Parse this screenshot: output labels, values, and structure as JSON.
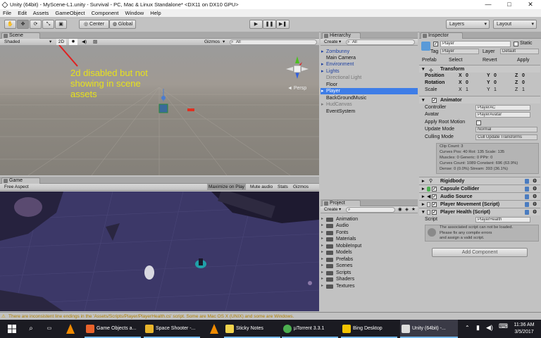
{
  "window": {
    "title": "Unity (64bit) - MyScene-L1.unity - Survival - PC, Mac & Linux Standalone* <DX11 on DX10 GPU>",
    "controls": [
      "—",
      "□",
      "✕"
    ]
  },
  "menu": [
    "File",
    "Edit",
    "Assets",
    "GameObject",
    "Component",
    "Window",
    "Help"
  ],
  "toolbar": {
    "center_label": "Center",
    "global_label": "Global",
    "layers_label": "Layers",
    "layout_label": "Layout"
  },
  "scene": {
    "tab": "Scene",
    "shading": "Shaded",
    "mode_2d": "2D",
    "gizmos": "Gizmos",
    "search": "All",
    "persp": "◄ Persp",
    "annotation": [
      "2d disabled but not",
      "showing in scene",
      "assets"
    ],
    "colors": {
      "annotation": "#e8e21a",
      "arrow": "#e02020"
    }
  },
  "game": {
    "tab": "Game",
    "aspect": "Free Aspect",
    "toggles": [
      "Maximize on Play",
      "Mute audio",
      "Stats",
      "Gizmos"
    ]
  },
  "hierarchy": {
    "tab": "Hierarchy",
    "create": "Create",
    "search": "All",
    "items": [
      {
        "label": "Zombunny",
        "style": "prefab"
      },
      {
        "label": "Main Camera",
        "style": "normal"
      },
      {
        "label": "Environment",
        "style": "prefab-arrow"
      },
      {
        "label": "Lights",
        "style": "prefab-arrow"
      },
      {
        "label": "Directional Light",
        "style": "dim"
      },
      {
        "label": "Floor",
        "style": "normal"
      },
      {
        "label": "Player",
        "style": "selected"
      },
      {
        "label": "BackGroundMusic",
        "style": "normal"
      },
      {
        "label": "HudCanvas",
        "style": "dim-arrow"
      },
      {
        "label": "EventSystem",
        "style": "normal"
      }
    ]
  },
  "project": {
    "tab": "Project",
    "create": "Create",
    "folders": [
      "Animation",
      "Audio",
      "Fonts",
      "Materials",
      "MobileInput",
      "Models",
      "Prefabs",
      "Scenes",
      "Scripts",
      "Shaders",
      "Textures"
    ]
  },
  "inspector": {
    "tab": "Inspector",
    "name": "Player",
    "static": "Static",
    "tag_label": "Tag",
    "tag": "Player",
    "layer_label": "Layer",
    "layer": "Default",
    "prefab_label": "Prefab",
    "prefab_buttons": [
      "Select",
      "Revert",
      "Apply"
    ],
    "transform": {
      "title": "Transform",
      "rows": [
        {
          "label": "Position",
          "x": "0",
          "y": "0",
          "z": "0"
        },
        {
          "label": "Rotation",
          "x": "0",
          "y": "0",
          "z": "0"
        },
        {
          "label": "Scale",
          "x": "1",
          "y": "1",
          "z": "1"
        }
      ]
    },
    "animator": {
      "title": "Animator",
      "controller_label": "Controller",
      "controller": "PlayerAC",
      "avatar_label": "Avatar",
      "avatar": "PlayerAvatar",
      "root_motion_label": "Apply Root Motion",
      "update_label": "Update Mode",
      "update": "Normal",
      "culling_label": "Culling Mode",
      "culling": "Cull Update Transforms",
      "info": [
        "Clip Count: 3",
        "Curves Pos: 40 Rot: 135 Scale: 135",
        "Muscles: 0 Generic: 0 PPtr: 0",
        "Curves Count: 1089 Constant: 696 (63.9%)",
        "Dense: 0 (0.0%) Stream: 393 (36.1%)"
      ]
    },
    "components": [
      "Rigidbody",
      "Capsule Collider",
      "Audio Source",
      "Player Movement (Script)",
      "Player Health (Script)"
    ],
    "script_label": "Script",
    "script_value": "PlayerHealth",
    "warning": [
      "The associated script can not be loaded.",
      "Please fix any compile errors",
      "and assign a valid script."
    ],
    "add_component": "Add Component"
  },
  "status": "There are inconsistent line endings in the 'Assets/Scripts/Player/PlayerHealth.cs' script. Some are Mac OS X (UNIX) and some are Windows.",
  "taskbar": {
    "apps": [
      {
        "label": "Game Objects a...",
        "color": "#e8622b"
      },
      {
        "label": "Space Shooter -...",
        "color": "#e8b42b"
      },
      {
        "label": "Sticky Notes",
        "color": "#f2d34c"
      },
      {
        "label": "µTorrent 3.3.1",
        "color": "#4caf50"
      },
      {
        "label": "Bing Desktop",
        "color": "#f5c400"
      },
      {
        "label": "Unity (64bit) -...",
        "color": "#dddddd"
      }
    ],
    "time": "11:36 AM",
    "date": "3/5/2017"
  }
}
